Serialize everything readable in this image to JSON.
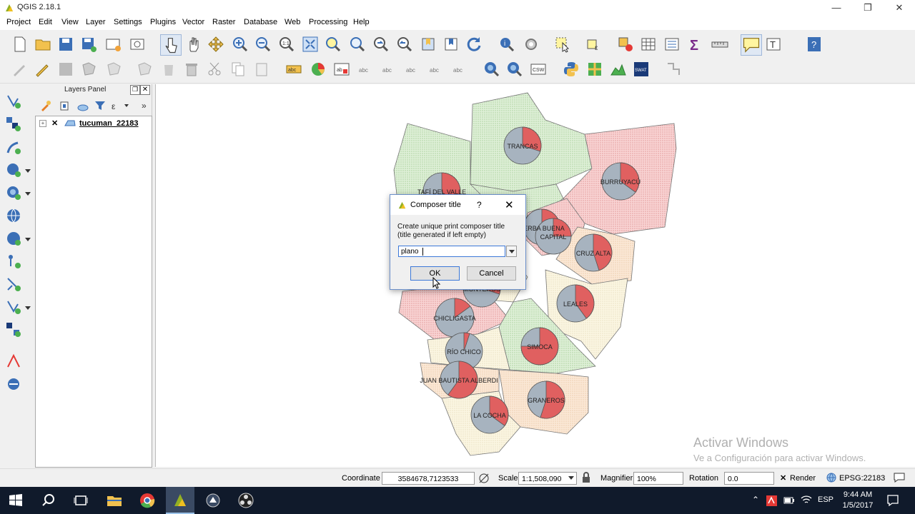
{
  "window": {
    "title": "QGIS 2.18.1"
  },
  "menu": [
    "Project",
    "Edit",
    "View",
    "Layer",
    "Settings",
    "Plugins",
    "Vector",
    "Raster",
    "Database",
    "Web",
    "Processing",
    "Help"
  ],
  "layers_panel": {
    "title": "Layers Panel",
    "layer_name": "tucuman_22183"
  },
  "dialog": {
    "title": "Composer title",
    "help": "?",
    "prompt_line1": "Create unique print composer title",
    "prompt_line2": "(title generated if left empty)",
    "input_value": "plano",
    "ok_label": "OK",
    "cancel_label": "Cancel"
  },
  "map_labels": [
    "TRANCAS",
    "BURRUYACÚ",
    "TAFÍ DEL VALLE",
    "YERBA BUENA",
    "CAPITAL",
    "CRUZ ALTA",
    "LEALES",
    "MONTEROS",
    "CHICLIGASTA",
    "RÍO CHICO",
    "SIMOCA",
    "JUAN BAUTISTA ALBERDI",
    "GRANEROS",
    "LA COCHA"
  ],
  "status": {
    "coordinate_label": "Coordinate",
    "coordinate_value": "3584678,7123533",
    "scale_label": "Scale",
    "scale_value": "1:1,508,090",
    "magnifier_label": "Magnifier",
    "magnifier_value": "100%",
    "rotation_label": "Rotation",
    "rotation_value": "0.0",
    "render_label": "Render",
    "crs_label": "EPSG:22183"
  },
  "watermark": {
    "line1": "Activar Windows",
    "line2": "Ve a Configuración para activar Windows."
  },
  "taskbar": {
    "time": "9:44 AM",
    "date": "1/5/2017",
    "lang": "ESP"
  },
  "colors": {
    "accent": "#3c78d8",
    "pie_red": "#e06060",
    "pie_grey": "#a7b3bf"
  }
}
